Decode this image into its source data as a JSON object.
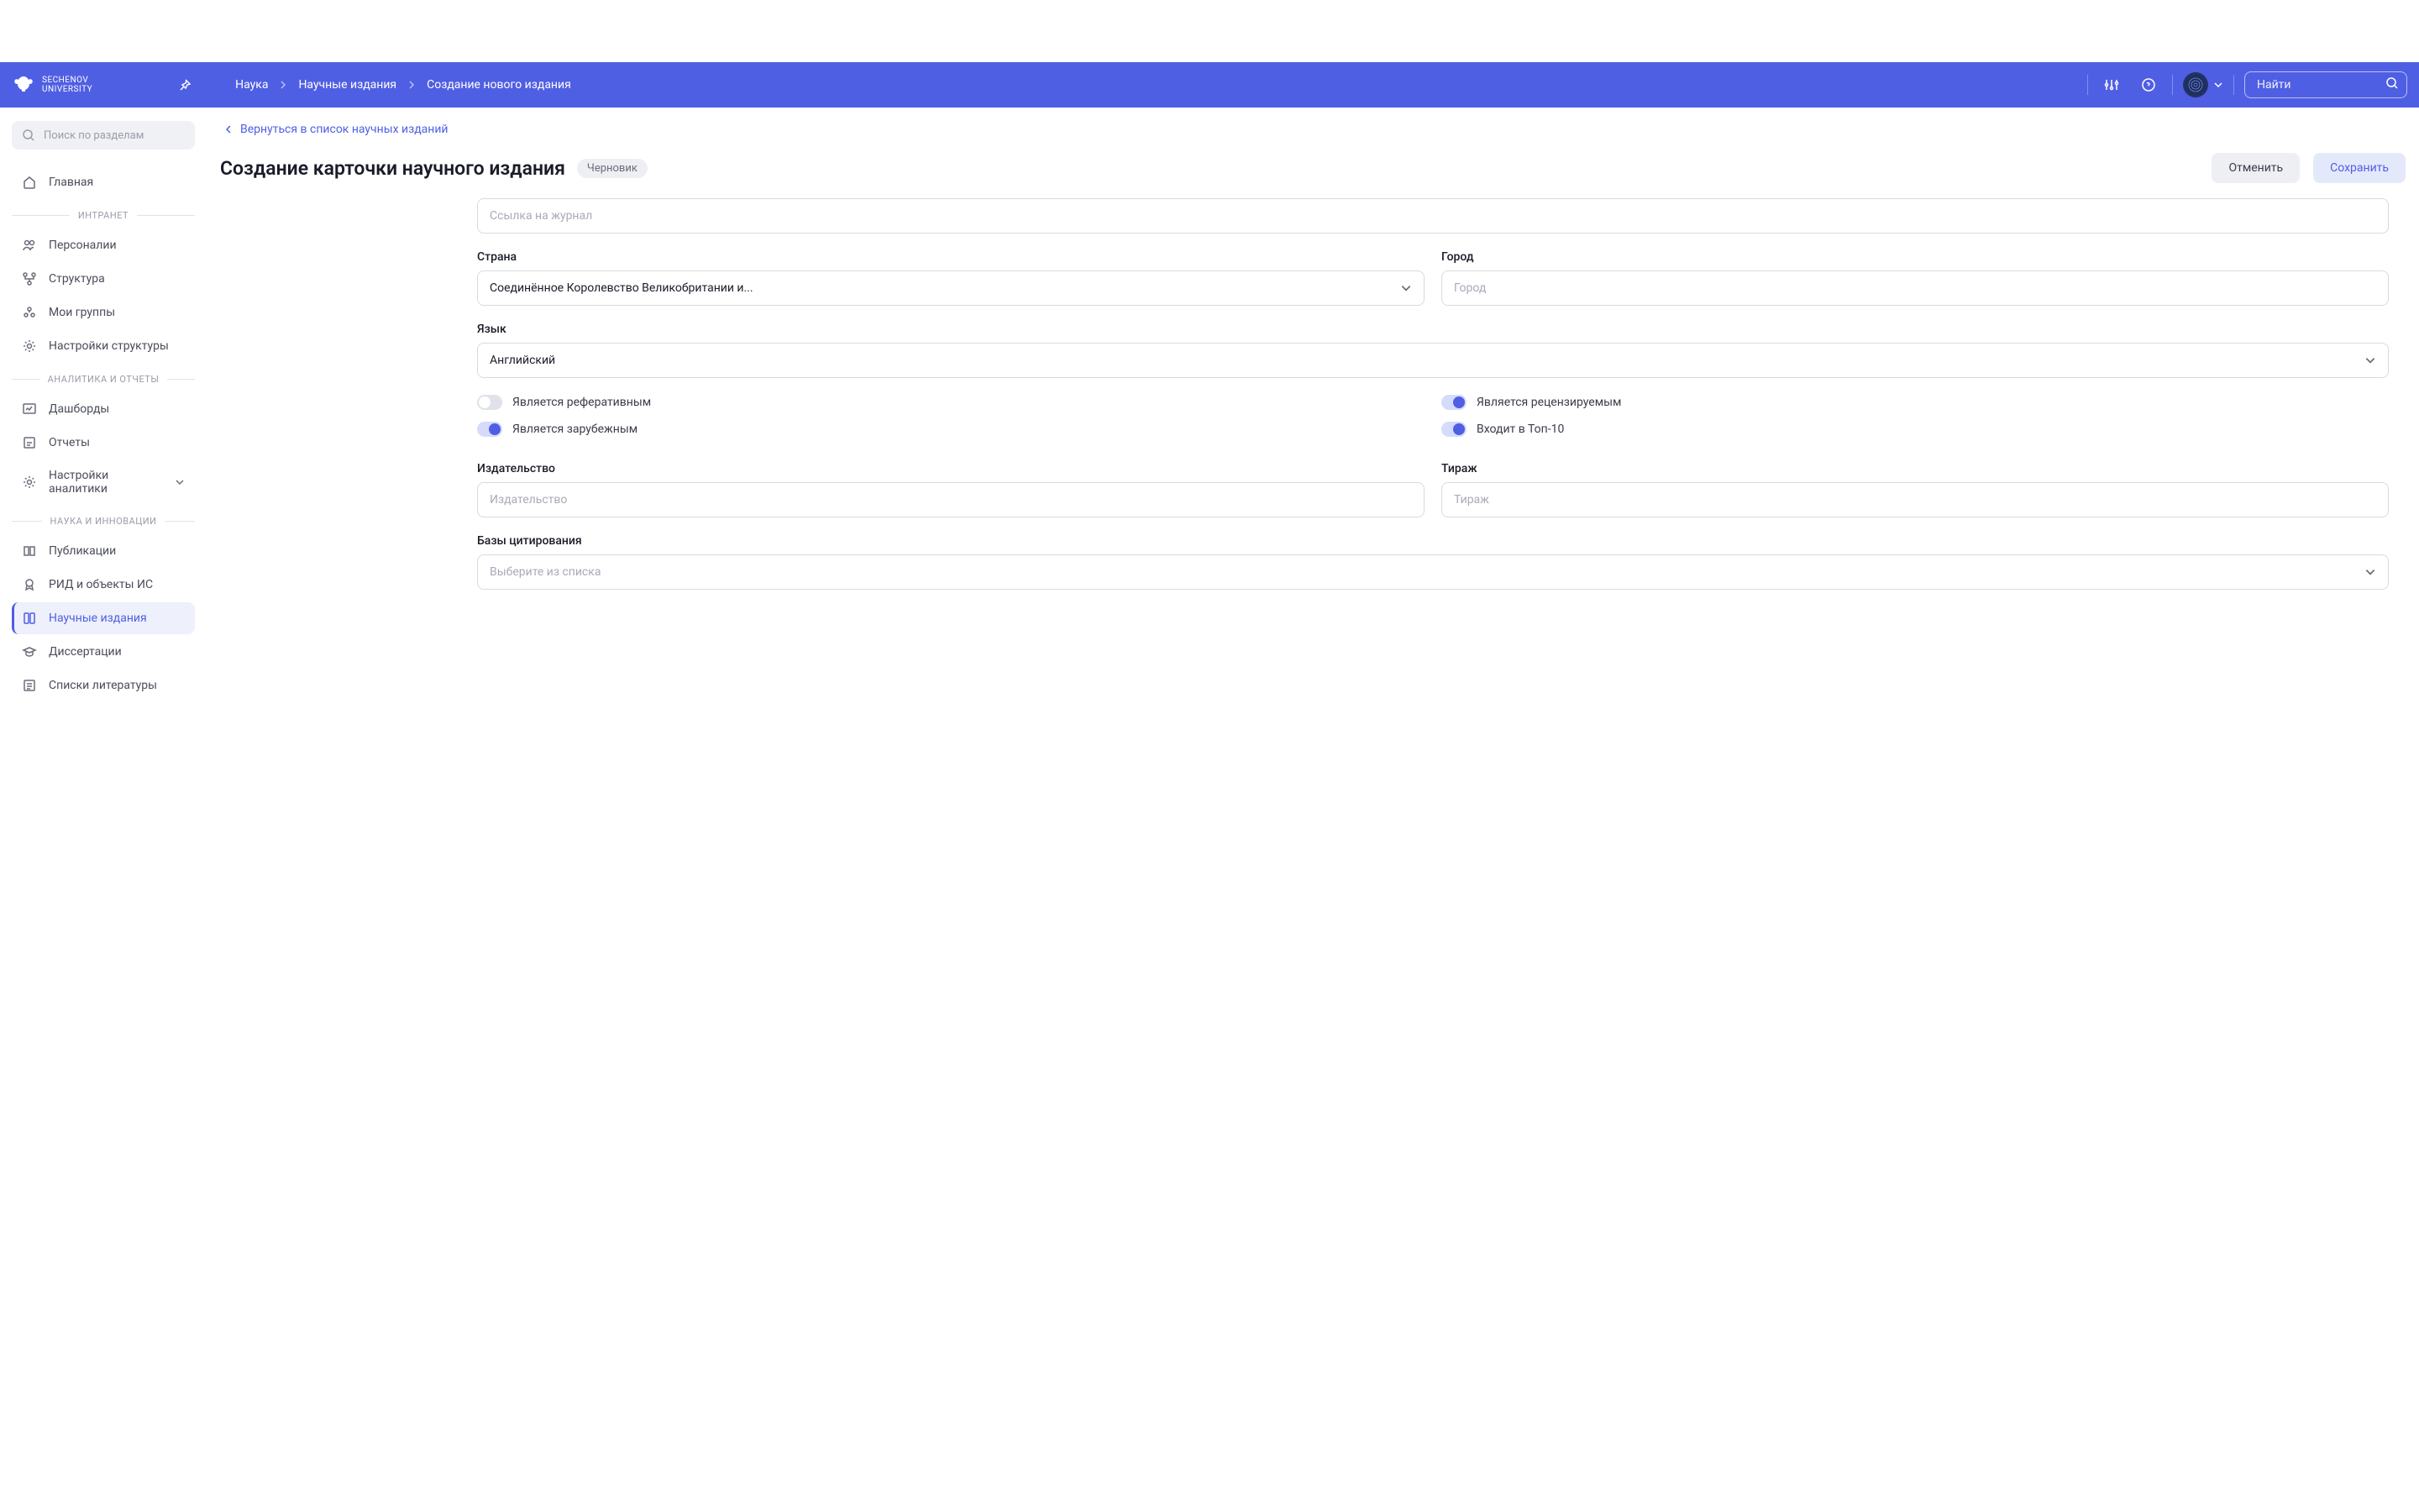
{
  "logo": {
    "line1": "SECHENOV",
    "line2": "UNIVERSITY"
  },
  "breadcrumb": [
    "Наука",
    "Научные издания",
    "Создание нового издания"
  ],
  "search": {
    "placeholder": "Найти"
  },
  "sidebar": {
    "search_placeholder": "Поиск по разделам",
    "items": {
      "home": "Главная",
      "personalii": "Персоналии",
      "struktura": "Структура",
      "moi_gruppy": "Мои группы",
      "nastroiki_struktury": "Настройки структуры",
      "dashbordy": "Дашборды",
      "otchety": "Отчеты",
      "nastroiki_analitiki": "Настройки аналитики",
      "publikacii": "Публикации",
      "rid": "РИД и объекты ИС",
      "nauchnye_izdaniya": "Научные издания",
      "dissertacii": "Диссертации",
      "spiski_literatury": "Списки литературы"
    },
    "sections": {
      "intranet": "ИНТРАНЕТ",
      "analytics": "АНАЛИТИКА И ОТЧЕТЫ",
      "science": "НАУКА И ИННОВАЦИИ"
    }
  },
  "back_link": "Вернуться в список научных изданий",
  "page_title": "Создание карточки научного издания",
  "badge": "Черновик",
  "actions": {
    "cancel": "Отменить",
    "save": "Сохранить"
  },
  "form": {
    "journal_link_placeholder": "Ссылка на журнал",
    "country_label": "Страна",
    "country_value": "Соединённое Королевство Великобритании и...",
    "city_label": "Город",
    "city_placeholder": "Город",
    "language_label": "Язык",
    "language_value": "Английский",
    "toggle_referative": "Является реферативным",
    "toggle_reviewed": "Является рецензируемым",
    "toggle_foreign": "Является зарубежным",
    "toggle_top10": "Входит в Топ-10",
    "publisher_label": "Издательство",
    "publisher_placeholder": "Издательство",
    "circulation_label": "Тираж",
    "circulation_placeholder": "Тираж",
    "citation_label": "Базы цитирования",
    "citation_placeholder": "Выберите из списка"
  }
}
